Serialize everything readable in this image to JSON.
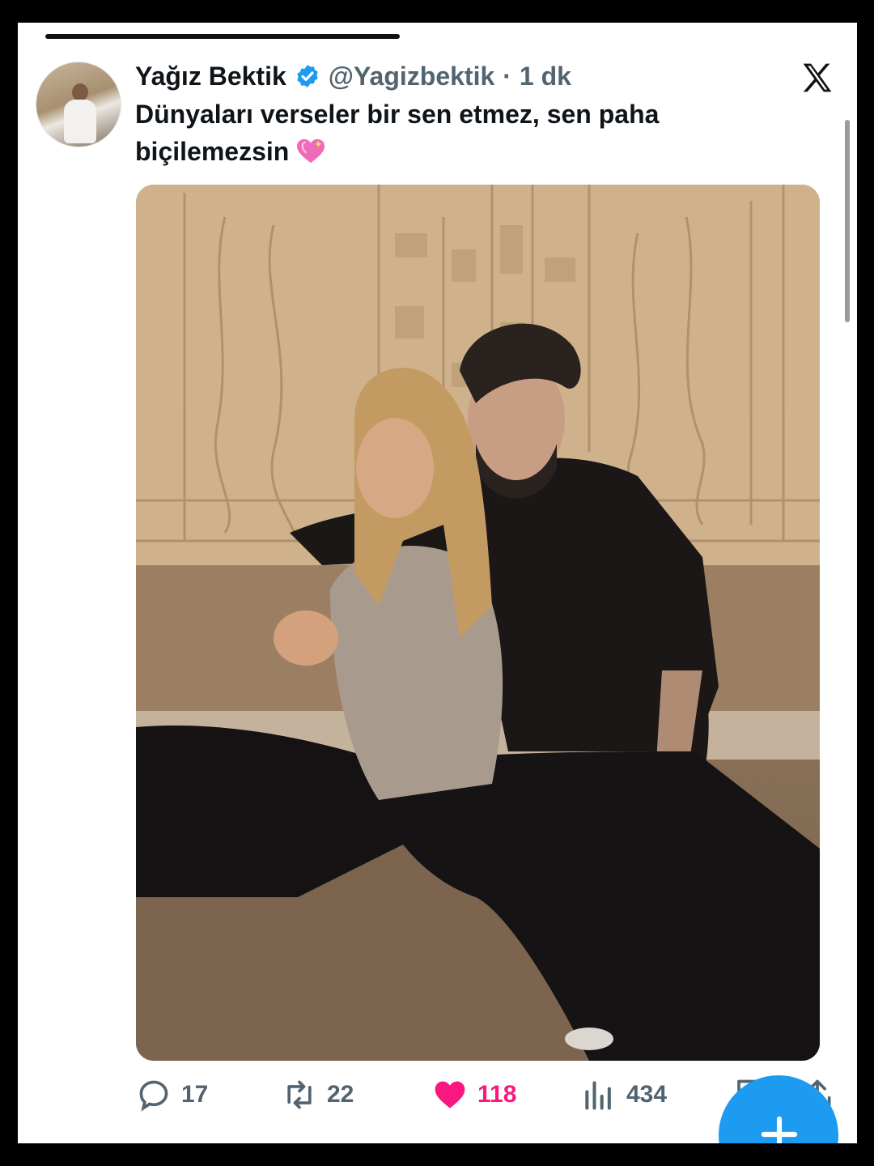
{
  "tweet": {
    "author_name": "Yağız Bektik",
    "handle": "@Yagizbektik",
    "separator": "·",
    "time": "1 dk",
    "text": "Dünyaları verseler bir sen etmez, sen paha biçilemezsin",
    "emoji": "sparkling-heart",
    "verified": true
  },
  "metrics": {
    "replies": "17",
    "retweets": "22",
    "likes": "118",
    "views": "434"
  },
  "colors": {
    "verified_blue": "#1d9bf0",
    "like_pink": "#f91880",
    "text_primary": "#0f1419",
    "text_secondary": "#536471",
    "fab_blue": "#1d9bf0"
  },
  "icons": {
    "brand": "x-logo-icon",
    "verified": "verified-badge-icon",
    "reply": "reply-icon",
    "retweet": "retweet-icon",
    "like": "heart-icon",
    "views": "views-icon",
    "bookmark": "bookmark-icon",
    "share": "share-icon",
    "compose": "plus-icon"
  }
}
